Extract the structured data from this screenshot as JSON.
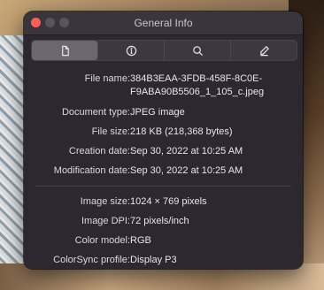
{
  "window": {
    "title": "General Info"
  },
  "toolbar": {
    "items": [
      {
        "name": "document-icon",
        "active": true
      },
      {
        "name": "info-icon",
        "active": false
      },
      {
        "name": "search-icon",
        "active": false
      },
      {
        "name": "pencil-icon",
        "active": false
      }
    ]
  },
  "info": {
    "file_name": {
      "label": "File name:",
      "line1": "384B3EAA-3FDB-458F-8C0E-",
      "line2": "F9ABA90B5506_1_105_c.jpeg"
    },
    "document_type": {
      "label": "Document type:",
      "value": "JPEG image"
    },
    "file_size": {
      "label": "File size:",
      "value": "218 KB (218,368 bytes)"
    },
    "creation_date": {
      "label": "Creation date:",
      "value": "Sep 30, 2022 at 10:25 AM"
    },
    "modification_date": {
      "label": "Modification date:",
      "value": "Sep 30, 2022 at 10:25 AM"
    },
    "image_size": {
      "label": "Image size:",
      "value": "1024 × 769 pixels"
    },
    "image_dpi": {
      "label": "Image DPI:",
      "value": "72 pixels/inch"
    },
    "color_model": {
      "label": "Color model:",
      "value": "RGB"
    },
    "colorsync_profile": {
      "label": "ColorSync profile:",
      "value": "Display P3"
    }
  },
  "colors": {
    "window_bg": "#2b2830",
    "close_button": "#ff5f57"
  }
}
